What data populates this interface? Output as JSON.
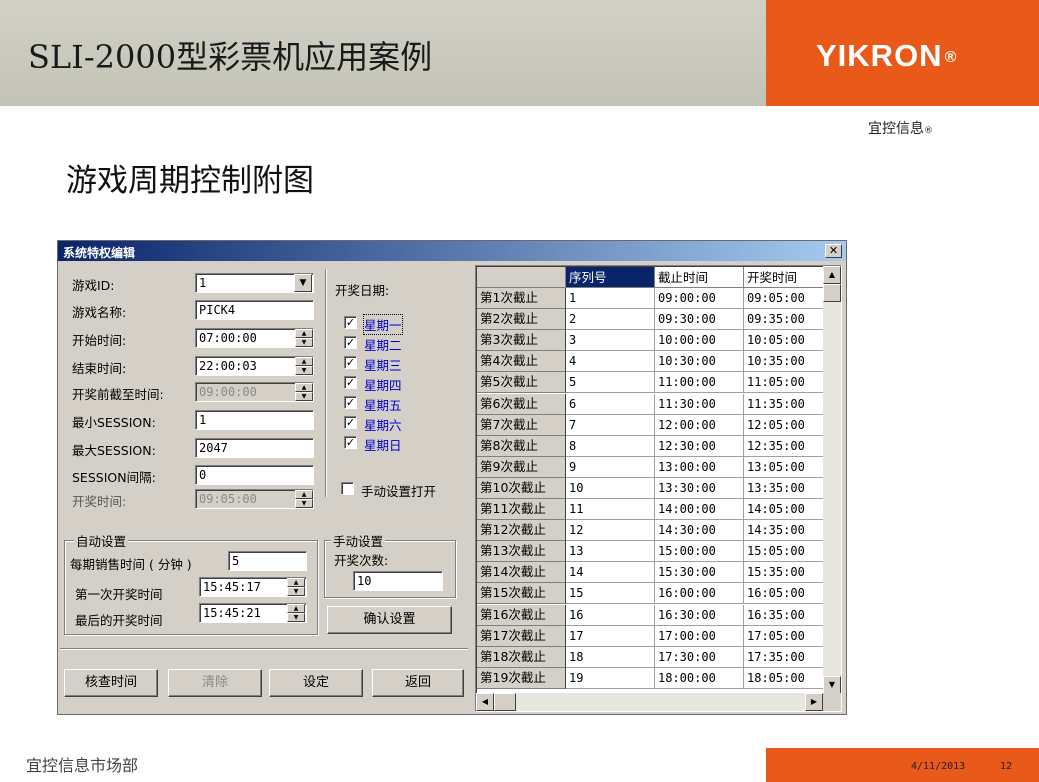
{
  "slide": {
    "title": "SLI-2000型彩票机应用案例",
    "brand": "YIKRON",
    "brand_reg": "®",
    "brand_sub": "宜控信息",
    "brand_sub_reg": "®",
    "section_title": "游戏周期控制附图",
    "footer_dept": "宜控信息市场部",
    "footer_date": "4/11/2013",
    "page_number": "12",
    "accent_color": "#e8591a"
  },
  "dialog": {
    "title": "系统特权编辑",
    "close_glyph": "✕",
    "fields": {
      "game_id": {
        "label": "游戏ID:",
        "value": "1"
      },
      "game_name": {
        "label": "游戏名称:",
        "value": "PICK4"
      },
      "start_time": {
        "label": "开始时间:",
        "value": "07:00:00"
      },
      "end_time": {
        "label": "结束时间:",
        "value": "22:00:03"
      },
      "cutoff_before_draw": {
        "label": "开奖前截至时间:",
        "value": "09:00:00"
      },
      "min_session": {
        "label": "最小SESSION:",
        "value": "1"
      },
      "max_session": {
        "label": "最大SESSION:",
        "value": "2047"
      },
      "session_interval": {
        "label": "SESSION间隔:",
        "value": "0"
      },
      "draw_time": {
        "label": "开奖时间:",
        "value": "09:05:00"
      }
    },
    "draw_days": {
      "label": "开奖日期:",
      "days": [
        {
          "label": "星期一",
          "checked": "☑"
        },
        {
          "label": "星期二",
          "checked": "☑"
        },
        {
          "label": "星期三",
          "checked": "☑"
        },
        {
          "label": "星期四",
          "checked": "☑"
        },
        {
          "label": "星期五",
          "checked": "☑"
        },
        {
          "label": "星期六",
          "checked": "☑"
        },
        {
          "label": "星期日",
          "checked": "☑"
        }
      ],
      "manual_open_label": "手动设置打开"
    },
    "auto_settings": {
      "legend": "自动设置",
      "sale_minutes": {
        "label": "每期销售时间 ( 分钟 )",
        "value": "5"
      },
      "first_draw": {
        "label": "第一次开奖时间",
        "value": "15:45:17"
      },
      "last_draw": {
        "label": "最后的开奖时间",
        "value": "15:45:21"
      }
    },
    "manual_settings": {
      "legend": "手动设置",
      "draw_count_label": "开奖次数:",
      "draw_count_value": "10",
      "confirm_label": "确认设置"
    },
    "buttons": {
      "check_time": "核查时间",
      "clear": "清除",
      "set": "设定",
      "back": "返回"
    },
    "grid": {
      "columns": [
        "序列号",
        "截止时间",
        "开奖时间"
      ],
      "rows": [
        {
          "header": "第1次截止",
          "seq": "1",
          "cutoff": "09:00:00",
          "draw": "09:05:00"
        },
        {
          "header": "第2次截止",
          "seq": "2",
          "cutoff": "09:30:00",
          "draw": "09:35:00"
        },
        {
          "header": "第3次截止",
          "seq": "3",
          "cutoff": "10:00:00",
          "draw": "10:05:00"
        },
        {
          "header": "第4次截止",
          "seq": "4",
          "cutoff": "10:30:00",
          "draw": "10:35:00"
        },
        {
          "header": "第5次截止",
          "seq": "5",
          "cutoff": "11:00:00",
          "draw": "11:05:00"
        },
        {
          "header": "第6次截止",
          "seq": "6",
          "cutoff": "11:30:00",
          "draw": "11:35:00"
        },
        {
          "header": "第7次截止",
          "seq": "7",
          "cutoff": "12:00:00",
          "draw": "12:05:00"
        },
        {
          "header": "第8次截止",
          "seq": "8",
          "cutoff": "12:30:00",
          "draw": "12:35:00"
        },
        {
          "header": "第9次截止",
          "seq": "9",
          "cutoff": "13:00:00",
          "draw": "13:05:00"
        },
        {
          "header": "第10次截止",
          "seq": "10",
          "cutoff": "13:30:00",
          "draw": "13:35:00"
        },
        {
          "header": "第11次截止",
          "seq": "11",
          "cutoff": "14:00:00",
          "draw": "14:05:00"
        },
        {
          "header": "第12次截止",
          "seq": "12",
          "cutoff": "14:30:00",
          "draw": "14:35:00"
        },
        {
          "header": "第13次截止",
          "seq": "13",
          "cutoff": "15:00:00",
          "draw": "15:05:00"
        },
        {
          "header": "第14次截止",
          "seq": "14",
          "cutoff": "15:30:00",
          "draw": "15:35:00"
        },
        {
          "header": "第15次截止",
          "seq": "15",
          "cutoff": "16:00:00",
          "draw": "16:05:00"
        },
        {
          "header": "第16次截止",
          "seq": "16",
          "cutoff": "16:30:00",
          "draw": "16:35:00"
        },
        {
          "header": "第17次截止",
          "seq": "17",
          "cutoff": "17:00:00",
          "draw": "17:05:00"
        },
        {
          "header": "第18次截止",
          "seq": "18",
          "cutoff": "17:30:00",
          "draw": "17:35:00"
        },
        {
          "header": "第19次截止",
          "seq": "19",
          "cutoff": "18:00:00",
          "draw": "18:05:00"
        }
      ]
    },
    "icons": {
      "combo_arrow": "▼",
      "spin_up": "▲",
      "spin_down": "▼",
      "scroll_up": "▲",
      "scroll_down": "▼",
      "scroll_left": "◀",
      "scroll_right": "▶"
    }
  }
}
